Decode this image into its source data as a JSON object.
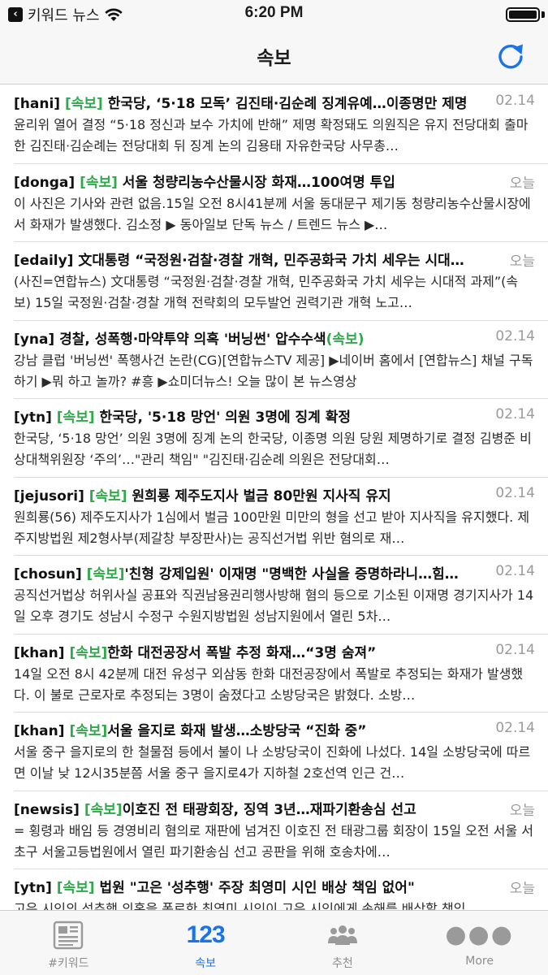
{
  "status_bar": {
    "back_app": "키워드 뉴스",
    "time": "6:20 PM"
  },
  "nav": {
    "title": "속보"
  },
  "colors": {
    "accent": "#1a73e8",
    "tag": "#2fa94a",
    "date": "#9a9a9a"
  },
  "news": [
    {
      "source": "[hani] ",
      "tag": "[속보]",
      "title": " 한국당, ‘5·18 모독’ 김진태·김순례 징계유예…이종명만 제명",
      "date": "02.14",
      "body": "윤리위 열어 결정 “5·18 정신과 보수 가치에 반해” 제명 확정돼도 의원직은 유지 전당대회 출마한 김진태·김순례는 전당대회 뒤 징계 논의 김용태 자유한국당 사무총…",
      "body_tag": ""
    },
    {
      "source": "[donga] ",
      "tag": "[속보]",
      "title": " 서울 청량리농수산물시장 화재…100여명 투입",
      "date": "오늘",
      "body": "이 사진은 기사와 관련 없음.15일 오전 8시41분께 서울 동대문구 제기동 청량리농수산물시장에서 화재가 발생했다. 김소정 ▶ 동아일보 단독 뉴스 / 트렌드 뉴스 ▶…",
      "body_tag": ""
    },
    {
      "source": "[edaily] ",
      "tag": "",
      "title": "文대통령 “국정원·검찰·경찰 개혁, 민주공화국 가치 세우는 시대…",
      "date": "오늘",
      "body": "(사진=연합뉴스)  文대통령 “국정원·검찰·경찰 개혁, 민주공화국 가치 세우는 시대적 과제”(속보) 15일 국정원·검찰·경찰 개혁 전략회의 모두발언 권력기관 개혁 노고…",
      "body_tag": ""
    },
    {
      "source": "[yna] ",
      "tag": "",
      "title": "경찰, 성폭행·마약투약 의혹 '버닝썬' 압수수색",
      "title_tag": "(속보)",
      "date": "02.14",
      "body": "강남 클럽 '버닝썬' 폭행사건 논란(CG)[연합뉴스TV 제공] ▶네이버 홈에서 [연합뉴스] 채널 구독하기 ▶뭐 하고 놀까? #흥 ▶쇼미더뉴스! 오늘 많이 본 뉴스영상",
      "body_tag": ""
    },
    {
      "source": "[ytn] ",
      "tag": "[속보]",
      "title": " 한국당, '5·18 망언' 의원 3명에 징계 확정",
      "date": "02.14",
      "body": "한국당, ‘5·18 망언’ 의원 3명에 징계 논의 한국당, 이종명 의원 당원 제명하기로 결정 김병준 비상대책위원장 ‘주의’…\"관리 책임\" \"김진태·김순례 의원은 전당대회…",
      "body_tag": ""
    },
    {
      "source": "[jejusori] ",
      "tag": "[속보]",
      "title": " 원희룡 제주도지사 벌금 80만원 지사직 유지",
      "date": "02.14",
      "body": "원희룡(56) 제주도지사가 1심에서 벌금 100만원 미만의 형을 선고 받아 지사직을 유지했다. 제주지방법원 제2형사부(제갈창 부장판사)는 공직선거법 위반 혐의로 재…",
      "body_tag": ""
    },
    {
      "source": "[chosun] ",
      "tag": "[속보]",
      "title": "'친형 강제입원' 이재명 \"명백한 사실을 증명하라니…힘…",
      "date": "02.14",
      "body": "공직선거법상 허위사실 공표와 직권남용권리행사방해 혐의 등으로 기소된 이재명 경기지사가 14일 오후 경기도 성남시 수정구 수원지방법원 성남지원에서 열린 5차…",
      "body_tag": ""
    },
    {
      "source": "[khan] ",
      "tag": "[속보]",
      "title": "한화 대전공장서 폭발 추정 화재…“3명 숨져”",
      "date": "02.14",
      "body": "14일 오전 8시 42분께 대전 유성구 외삼동 한화 대전공장에서 폭발로 추정되는 화재가 발생했다. 이 불로 근로자로 추정되는 3명이 숨졌다고 소방당국은 밝혔다. 소방…",
      "body_tag": ""
    },
    {
      "source": "[khan] ",
      "tag": "[속보]",
      "title": "서울 을지로 화재 발생…소방당국 “진화 중”",
      "date": "02.14",
      "body": "서울 중구 을지로의 한 철물점 등에서 불이 나 소방당국이 진화에 나섰다. 14일 소방당국에 따르면 이날 낮 12시35분쯤 서울 중구 을지로4가 지하철 2호선역 인근 건…",
      "body_tag": ""
    },
    {
      "source": "[newsis] ",
      "tag": "[속보]",
      "title": "이호진 전 태광회장, 징역 3년…재파기환송심 선고",
      "date": "오늘",
      "body": "= 횡령과 배임 등 경영비리 혐의로 재판에 넘겨진 이호진 전 태광그룹 회장이 15일 오전 서울 서초구 서울고등법원에서 열린 파기환송심 선고 공판을 위해 호송차에…",
      "body_tag": ""
    },
    {
      "source": "[ytn] ",
      "tag": "[속보]",
      "title": " 법원 \"고은 '성추행' 주장 최영미 시인 배상 책임 없어\"",
      "date": "오늘",
      "body": "고은 시인의 성추행 의혹을 폭로한 최영미 시인이 고은 시인에게 손해를 배상할 책임…",
      "body_tag": ""
    }
  ],
  "tabs": [
    {
      "label": "#키워드",
      "icon": "newspaper-icon"
    },
    {
      "label": "속보",
      "icon": "numbers-123-icon",
      "icon_text": "123"
    },
    {
      "label": "추천",
      "icon": "people-icon"
    },
    {
      "label": "More",
      "icon": "more-dots-icon",
      "icon_text": "●●●"
    }
  ]
}
